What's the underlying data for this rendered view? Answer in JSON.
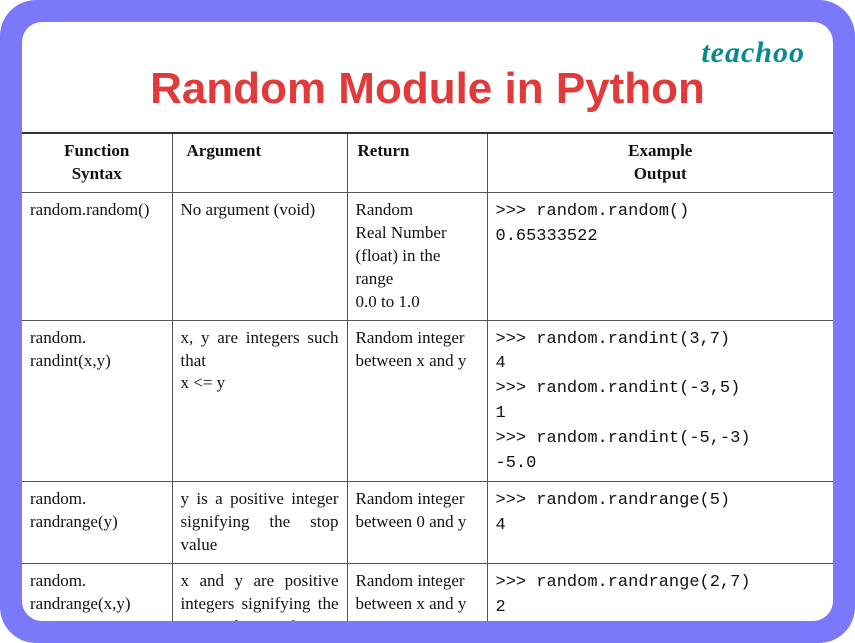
{
  "brand": "teachoo",
  "title": "Random Module in Python",
  "headers": {
    "syntax": "Function\nSyntax",
    "argument": "Argument",
    "ret": "Return",
    "example": "Example\nOutput"
  },
  "rows": [
    {
      "syntax": "random.random()",
      "argument": "No argument (void)",
      "ret": "Random\nReal Number (float) in the range\n0.0 to 1.0",
      "example": ">>> random.random()\n0.65333522"
    },
    {
      "syntax": "random.\nrandint(x,y)",
      "argument": "x, y are integers such that\nx <= y",
      "ret": "Random integer between x and y",
      "example": ">>> random.randint(3,7)\n4\n>>> random.randint(-3,5)\n1\n>>> random.randint(-5,-3)\n-5.0"
    },
    {
      "syntax": "random.\nrandrange(y)",
      "argument": "y is a positive integer signifying the stop value",
      "ret": "Random integer between 0 and y",
      "example": ">>> random.randrange(5)\n4"
    },
    {
      "syntax": "random.\nrandrange(x,y)",
      "argument": "x and y are positive integers signifying the start and stop value",
      "ret": "Random integer between x and y",
      "example": ">>> random.randrange(2,7)\n2"
    }
  ]
}
